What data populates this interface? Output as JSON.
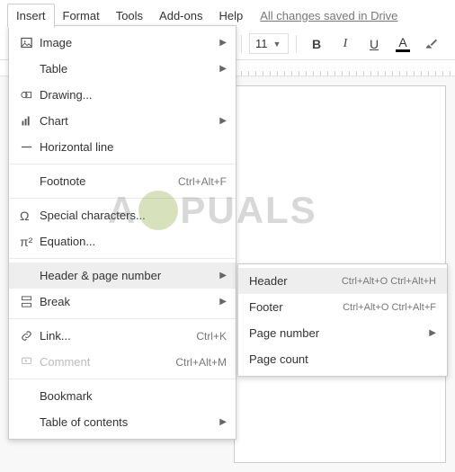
{
  "menubar": {
    "items": [
      "Insert",
      "Format",
      "Tools",
      "Add-ons",
      "Help"
    ],
    "active_index": 0,
    "saved_text": "All changes saved in Drive"
  },
  "toolbar": {
    "font_size": "11",
    "bold": "B",
    "italic": "I",
    "underline": "U",
    "text_color": "A"
  },
  "insert_menu": {
    "items": [
      {
        "icon": "image-icon",
        "label": "Image",
        "submenu": true
      },
      {
        "icon": "table-icon",
        "label": "Table",
        "submenu": true
      },
      {
        "icon": "drawing-icon",
        "label": "Drawing..."
      },
      {
        "icon": "chart-icon",
        "label": "Chart",
        "submenu": true
      },
      {
        "icon": "hr-icon",
        "label": "Horizontal line"
      },
      {
        "sep": true
      },
      {
        "icon": "",
        "label": "Footnote",
        "shortcut": "Ctrl+Alt+F"
      },
      {
        "sep": true
      },
      {
        "icon": "omega-icon",
        "label": "Special characters..."
      },
      {
        "icon": "pi-icon",
        "label": "Equation..."
      },
      {
        "sep": true
      },
      {
        "icon": "",
        "label": "Header & page number",
        "submenu": true,
        "highlighted": true
      },
      {
        "icon": "break-icon",
        "label": "Break",
        "submenu": true
      },
      {
        "sep": true
      },
      {
        "icon": "link-icon",
        "label": "Link...",
        "shortcut": "Ctrl+K"
      },
      {
        "icon": "comment-icon",
        "label": "Comment",
        "shortcut": "Ctrl+Alt+M",
        "disabled": true
      },
      {
        "sep": true
      },
      {
        "icon": "",
        "label": "Bookmark"
      },
      {
        "icon": "",
        "label": "Table of contents",
        "submenu": true
      }
    ]
  },
  "header_submenu": {
    "items": [
      {
        "label": "Header",
        "shortcut": "Ctrl+Alt+O Ctrl+Alt+H",
        "highlighted": true
      },
      {
        "label": "Footer",
        "shortcut": "Ctrl+Alt+O Ctrl+Alt+F"
      },
      {
        "label": "Page number",
        "submenu": true
      },
      {
        "label": "Page count"
      }
    ]
  },
  "watermark": {
    "left": "A",
    "right": "PUALS"
  }
}
